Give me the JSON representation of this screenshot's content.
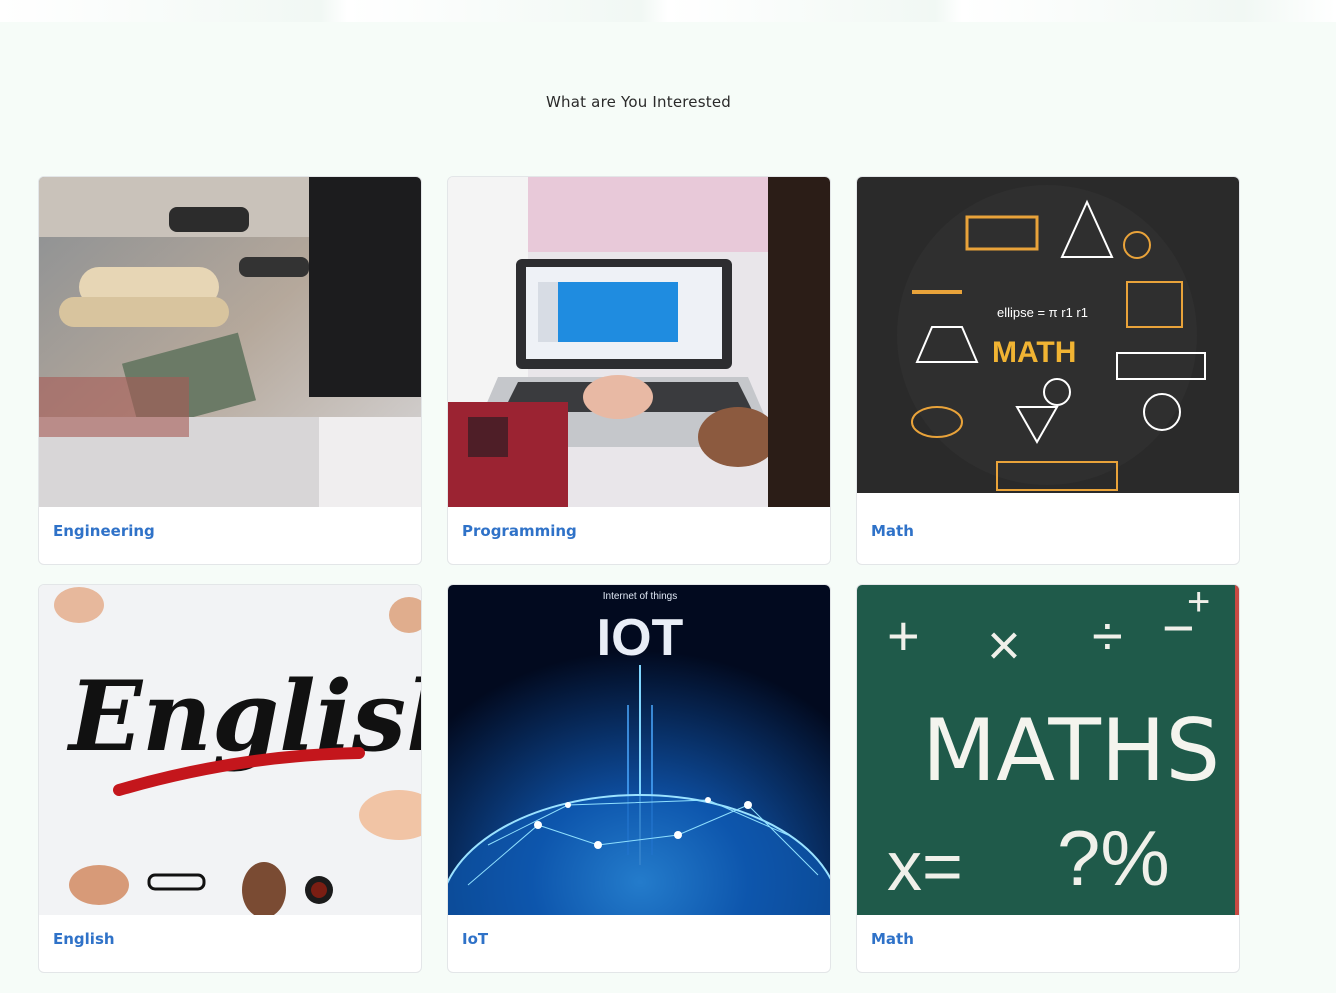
{
  "page": {
    "heading": "What are You Interested"
  },
  "categories": [
    {
      "label": "Engineering",
      "image": "engineering-photo"
    },
    {
      "label": "Programming",
      "image": "laptop-coding-photo"
    },
    {
      "label": "Math",
      "image": "math-chalkboard-formulas",
      "image_text": "MATH"
    },
    {
      "label": "English",
      "image": "english-handwriting-photo",
      "image_text": "English"
    },
    {
      "label": "IoT",
      "image": "iot-network-globe",
      "image_text_small": "Internet of things",
      "image_text": "IOT"
    },
    {
      "label": "Math",
      "image": "maths-green-chalkboard",
      "image_text": "MATHS"
    }
  ],
  "colors": {
    "background": "#f6fcf8",
    "label": "#2f72c8",
    "heading": "#2a2a2a"
  }
}
